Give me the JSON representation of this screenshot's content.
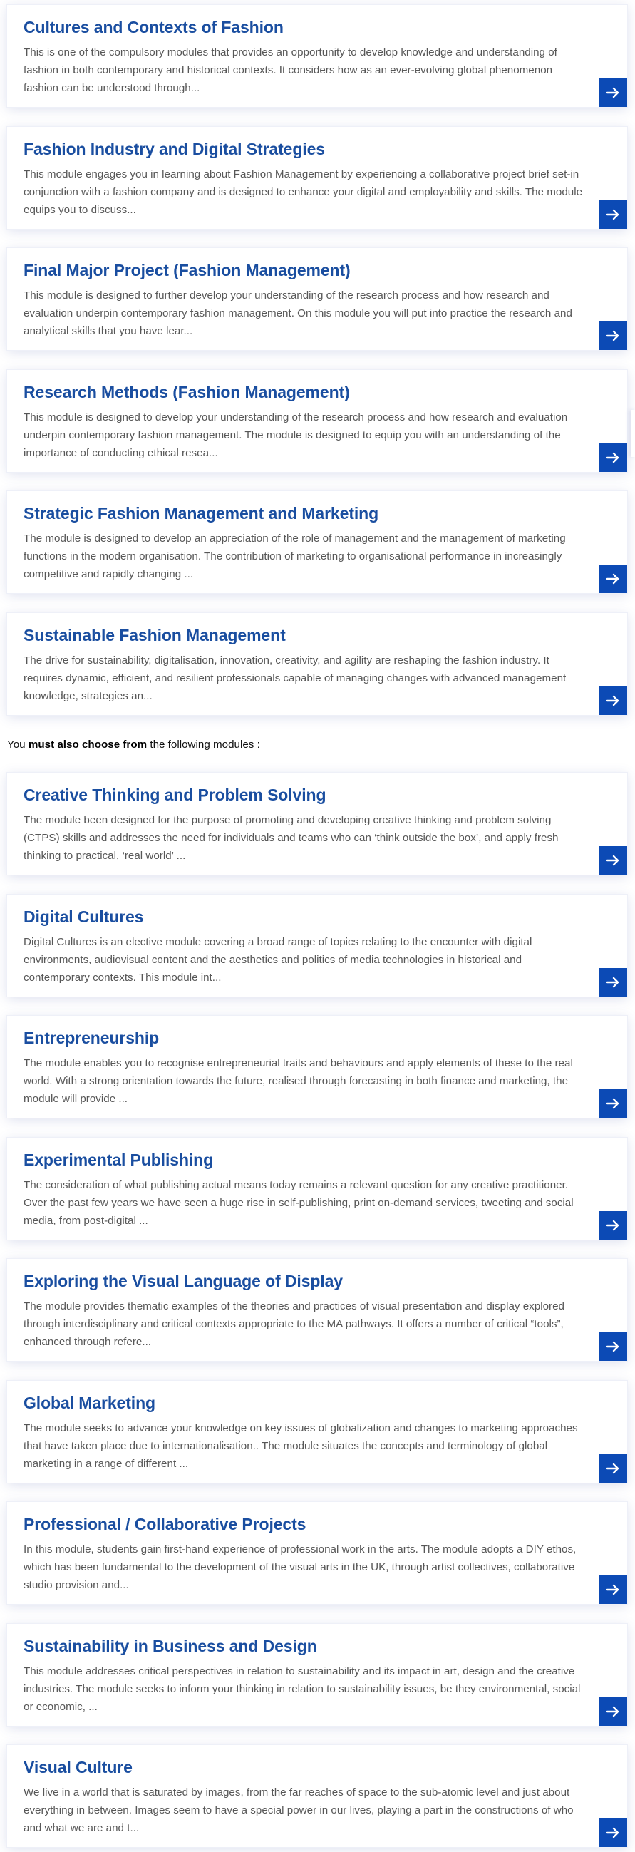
{
  "colors": {
    "title": "#1a4ea0",
    "arrow_button": "#0c4ab5",
    "card_shadow": "#dfe4f4"
  },
  "arrow_icon": "arrow-right-icon",
  "core_modules": [
    {
      "title": "Cultures and Contexts of Fashion",
      "description": "This is one of the compulsory modules that provides an opportunity to develop knowledge and understanding of fashion in both contemporary and historical contexts. It considers how as an ever-evolving global phenomenon fashion can be understood through..."
    },
    {
      "title": "Fashion Industry and Digital Strategies",
      "description": "This module engages you in learning about Fashion Management by experiencing a collaborative project brief set-in conjunction with a fashion company and is designed to enhance your digital and employability and skills. The module equips you to discuss..."
    },
    {
      "title": "Final Major Project (Fashion Management)",
      "description": "This module is designed to further develop your understanding of the research process and how research and evaluation underpin contemporary fashion management. On this module you will put into practice the research and analytical skills that you have lear..."
    },
    {
      "title": "Research Methods (Fashion Management)",
      "description": "This module is designed to develop your understanding of the research process and how research and evaluation underpin contemporary fashion management. The module is designed to equip you with an understanding of the importance of conducting ethical resea..."
    },
    {
      "title": "Strategic Fashion Management and Marketing",
      "description": "The module is designed to develop an appreciation of the role of management and the management of marketing functions in the modern organisation. The contribution of marketing to organisational performance in increasingly competitive and rapidly changing ..."
    },
    {
      "title": "Sustainable Fashion Management",
      "description": "The drive for sustainability, digitalisation, innovation, creativity, and agility are reshaping the fashion industry. It requires dynamic, efficient, and resilient professionals capable of managing changes with advanced management knowledge, strategies an..."
    }
  ],
  "intro": {
    "prefix": "You ",
    "emphasis": "must also choose from",
    "suffix": " the following modules :"
  },
  "elective_modules": [
    {
      "title": "Creative Thinking and Problem Solving",
      "description": "The module been designed for the purpose of promoting and developing creative thinking and problem solving (CTPS) skills and addresses the need for individuals and teams who can ‘think outside the box’, and apply fresh thinking to practical, ‘real world’ ..."
    },
    {
      "title": "Digital Cultures",
      "description": "Digital Cultures is an elective module covering a broad range of topics relating to the encounter with digital environments, audiovisual content and the aesthetics and politics of media technologies in historical and contemporary contexts. This module int..."
    },
    {
      "title": "Entrepreneurship",
      "description": "The module enables you to recognise entrepreneurial traits and behaviours and apply elements of these to the real world. With a strong orientation towards the future, realised through forecasting in both finance and marketing, the module will provide ..."
    },
    {
      "title": "Experimental Publishing",
      "description": "The consideration of what publishing actual means today remains a relevant question for any creative practitioner. Over the past few years we have seen a huge rise in self-publishing, print on-demand services, tweeting and social media, from post-digital ..."
    },
    {
      "title": "Exploring the Visual Language of Display",
      "description": "The module provides thematic examples of the theories and practices of visual presentation and display explored through interdisciplinary and critical contexts appropriate to the MA pathways. It offers a number of critical “tools”, enhanced through refere..."
    },
    {
      "title": "Global Marketing",
      "description": "The module seeks to advance your knowledge on key issues of globalization and changes to marketing approaches that have taken place due to internationalisation.. The module situates the concepts and terminology of global marketing in a range of different ..."
    },
    {
      "title": "Professional / Collaborative Projects",
      "description": "In this module, students gain first-hand experience of professional work in the arts. The module adopts a DIY ethos, which has been fundamental to the development of the visual arts in the UK, through artist collectives, collaborative studio provision and..."
    },
    {
      "title": "Sustainability in Business and Design",
      "description": "This module addresses critical perspectives in relation to sustainability and its impact in art, design and the creative industries. The module seeks to inform your thinking in relation to sustainability issues, be they environmental, social or economic, ..."
    },
    {
      "title": "Visual Culture",
      "description": "We live in a world that is saturated by images, from the far reaches of space to the sub-atomic level and just about everything in between. Images seem to have a special power in our lives, playing a part in the constructions of who and what we are and t..."
    }
  ]
}
